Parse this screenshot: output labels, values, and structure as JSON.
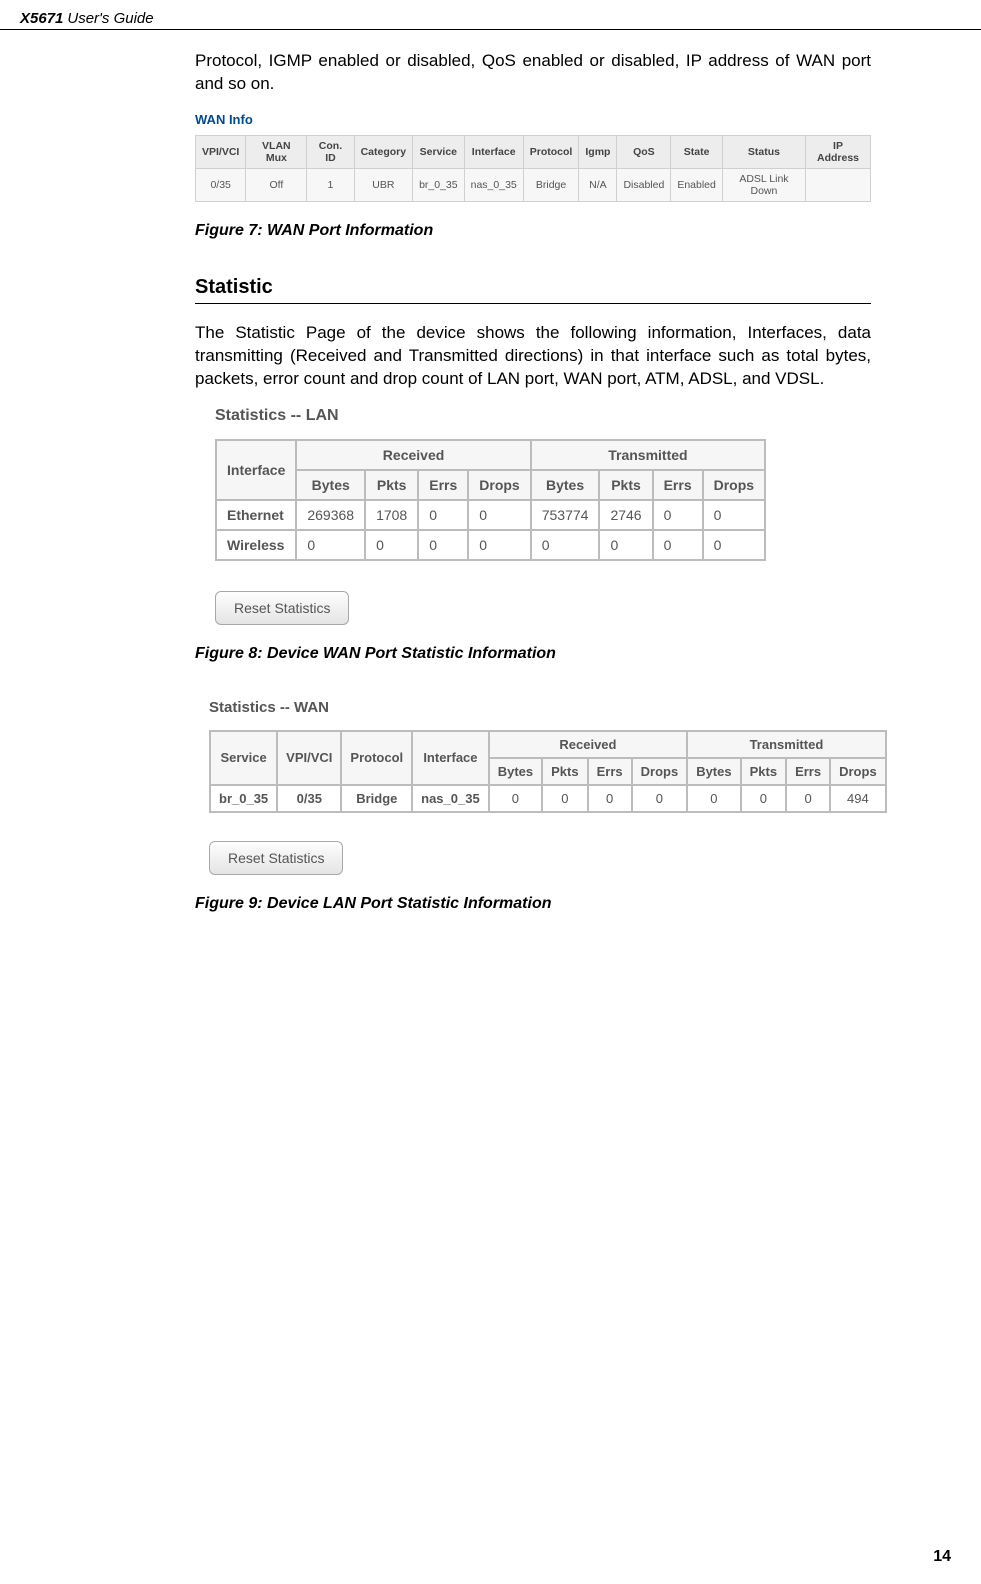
{
  "header": {
    "title": "X5671",
    "subtitle": "User's Guide"
  },
  "intro_cont": "Protocol, IGMP enabled or disabled, QoS enabled or disabled, IP address of WAN port and so on.",
  "wan_info": {
    "label": "WAN Info",
    "cols": [
      "VPI/VCI",
      "VLAN Mux",
      "Con. ID",
      "Category",
      "Service",
      "Interface",
      "Protocol",
      "Igmp",
      "QoS",
      "State",
      "Status",
      "IP Address"
    ],
    "row": [
      "0/35",
      "Off",
      "1",
      "UBR",
      "br_0_35",
      "nas_0_35",
      "Bridge",
      "N/A",
      "Disabled",
      "Enabled",
      "ADSL Link Down",
      ""
    ]
  },
  "fig7": "Figure 7: WAN Port Information",
  "section": "Statistic",
  "stat_body": "The Statistic Page of the device shows the following information, Interfaces, data transmitting (Received and Transmitted directions) in that interface such as total bytes, packets, error count and drop count of LAN port, WAN port, ATM, ADSL, and VDSL.",
  "lan": {
    "title": "Statistics -- LAN",
    "iface_h": "Interface",
    "group_r": "Received",
    "group_t": "Transmitted",
    "cols": [
      "Bytes",
      "Pkts",
      "Errs",
      "Drops",
      "Bytes",
      "Pkts",
      "Errs",
      "Drops"
    ],
    "rows": [
      {
        "iface": "Ethernet",
        "v": [
          "269368",
          "1708",
          "0",
          "0",
          "753774",
          "2746",
          "0",
          "0"
        ]
      },
      {
        "iface": "Wireless",
        "v": [
          "0",
          "0",
          "0",
          "0",
          "0",
          "0",
          "0",
          "0"
        ]
      }
    ],
    "reset": "Reset Statistics"
  },
  "fig8": "Figure 8: Device WAN Port Statistic Information",
  "wan": {
    "title": "Statistics -- WAN",
    "head1": [
      "Service",
      "VPI/VCI",
      "Protocol",
      "Interface"
    ],
    "group_r": "Received",
    "group_t": "Transmitted",
    "cols": [
      "Bytes",
      "Pkts",
      "Errs",
      "Drops",
      "Bytes",
      "Pkts",
      "Errs",
      "Drops"
    ],
    "row_a": [
      "br_0_35",
      "0/35",
      "Bridge",
      "nas_0_35"
    ],
    "row_b": [
      "0",
      "0",
      "0",
      "0",
      "0",
      "0",
      "0",
      "494"
    ],
    "reset": "Reset Statistics"
  },
  "fig9": "Figure 9: Device LAN Port Statistic Information",
  "page_no": "14"
}
